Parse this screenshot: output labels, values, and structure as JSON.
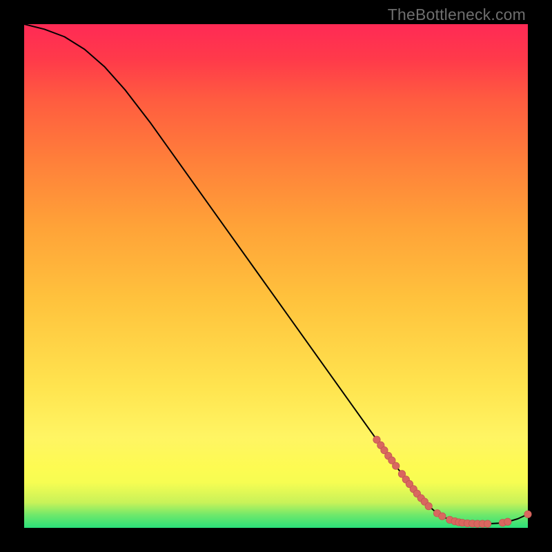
{
  "watermark": "TheBottleneck.com",
  "colors": {
    "curve_stroke": "#000000",
    "point_fill": "#d9675f",
    "point_stroke": "#c15751"
  },
  "chart_data": {
    "type": "line",
    "title": "",
    "xlabel": "",
    "ylabel": "",
    "xlim": [
      0,
      100
    ],
    "ylim": [
      0,
      100
    ],
    "grid": false,
    "curve": [
      {
        "x": 0,
        "y": 100
      },
      {
        "x": 4,
        "y": 99
      },
      {
        "x": 8,
        "y": 97.5
      },
      {
        "x": 12,
        "y": 95
      },
      {
        "x": 16,
        "y": 91.5
      },
      {
        "x": 20,
        "y": 87
      },
      {
        "x": 25,
        "y": 80.5
      },
      {
        "x": 30,
        "y": 73.5
      },
      {
        "x": 35,
        "y": 66.5
      },
      {
        "x": 40,
        "y": 59.5
      },
      {
        "x": 45,
        "y": 52.5
      },
      {
        "x": 50,
        "y": 45.5
      },
      {
        "x": 55,
        "y": 38.5
      },
      {
        "x": 60,
        "y": 31.5
      },
      {
        "x": 65,
        "y": 24.5
      },
      {
        "x": 70,
        "y": 17.5
      },
      {
        "x": 74,
        "y": 12.0
      },
      {
        "x": 78,
        "y": 6.8
      },
      {
        "x": 80,
        "y": 4.6
      },
      {
        "x": 82,
        "y": 2.9
      },
      {
        "x": 84,
        "y": 1.8
      },
      {
        "x": 86,
        "y": 1.2
      },
      {
        "x": 88,
        "y": 0.9
      },
      {
        "x": 90,
        "y": 0.8
      },
      {
        "x": 92,
        "y": 0.8
      },
      {
        "x": 94,
        "y": 0.9
      },
      {
        "x": 96,
        "y": 1.2
      },
      {
        "x": 98,
        "y": 1.8
      },
      {
        "x": 100,
        "y": 2.7
      }
    ],
    "points": [
      {
        "x": 70.0,
        "y": 17.5
      },
      {
        "x": 70.8,
        "y": 16.4
      },
      {
        "x": 71.5,
        "y": 15.4
      },
      {
        "x": 72.3,
        "y": 14.3
      },
      {
        "x": 73.0,
        "y": 13.4
      },
      {
        "x": 73.8,
        "y": 12.3
      },
      {
        "x": 75.0,
        "y": 10.7
      },
      {
        "x": 75.8,
        "y": 9.6
      },
      {
        "x": 76.5,
        "y": 8.7
      },
      {
        "x": 77.3,
        "y": 7.7
      },
      {
        "x": 78.0,
        "y": 6.8
      },
      {
        "x": 78.8,
        "y": 5.9
      },
      {
        "x": 79.5,
        "y": 5.2
      },
      {
        "x": 80.3,
        "y": 4.3
      },
      {
        "x": 82.0,
        "y": 2.9
      },
      {
        "x": 83.0,
        "y": 2.3
      },
      {
        "x": 84.5,
        "y": 1.6
      },
      {
        "x": 85.5,
        "y": 1.3
      },
      {
        "x": 86.3,
        "y": 1.1
      },
      {
        "x": 87.0,
        "y": 1.0
      },
      {
        "x": 88.0,
        "y": 0.9
      },
      {
        "x": 89.0,
        "y": 0.85
      },
      {
        "x": 90.0,
        "y": 0.8
      },
      {
        "x": 91.0,
        "y": 0.8
      },
      {
        "x": 92.0,
        "y": 0.8
      },
      {
        "x": 95.0,
        "y": 1.0
      },
      {
        "x": 96.0,
        "y": 1.2
      },
      {
        "x": 100.0,
        "y": 2.7
      }
    ]
  }
}
